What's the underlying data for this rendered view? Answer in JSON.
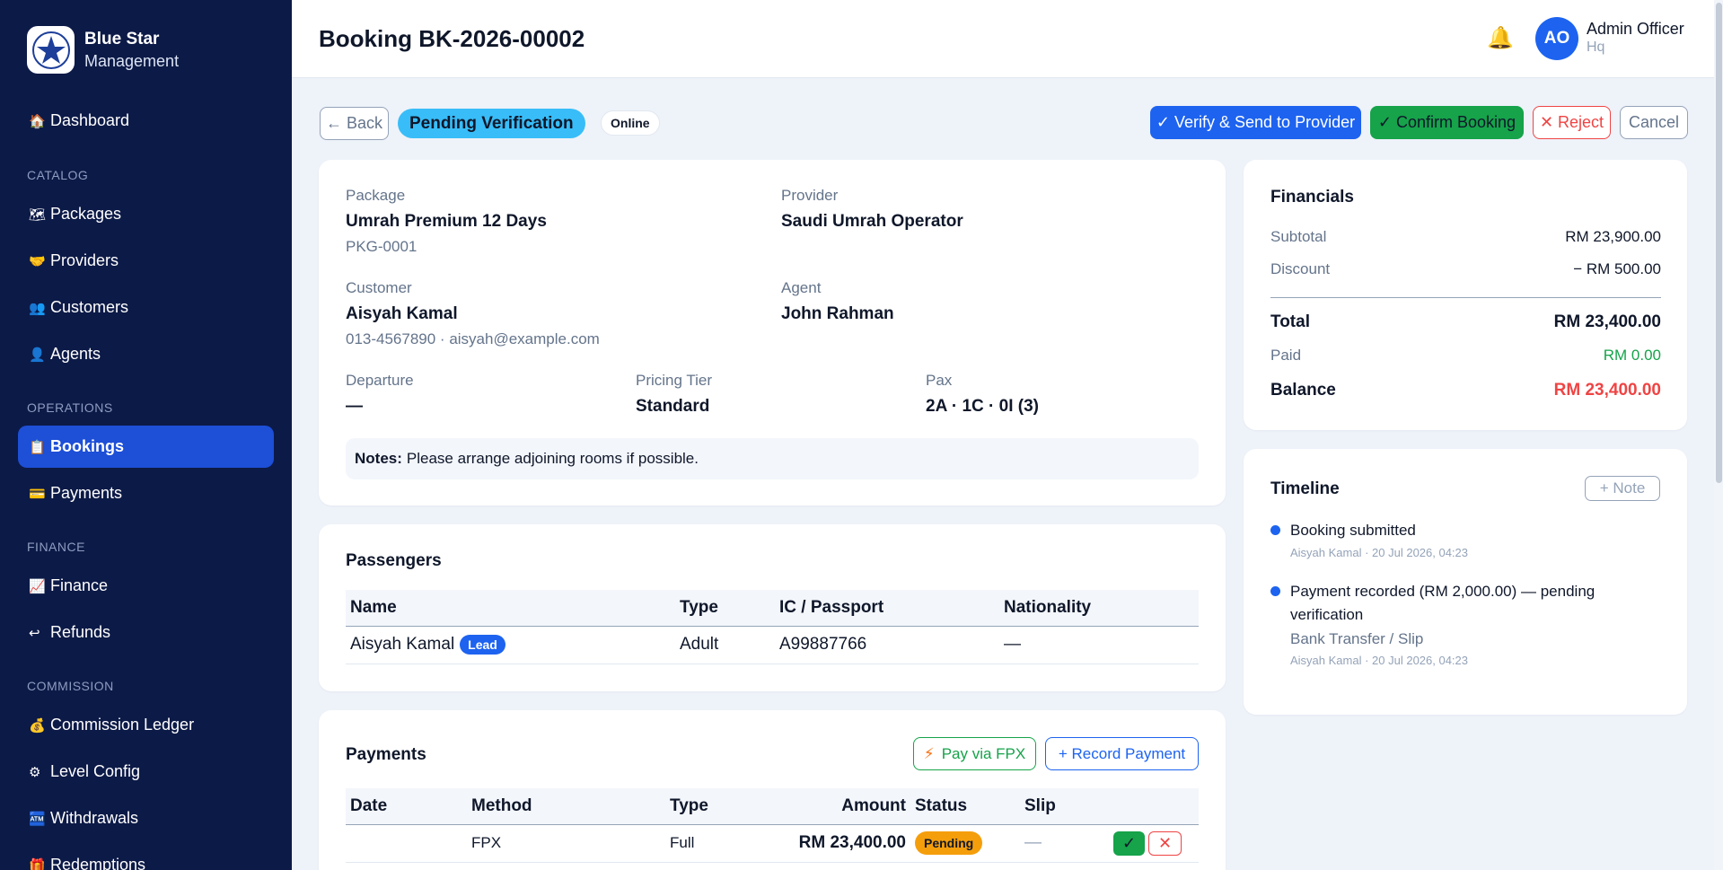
{
  "brand": {
    "name": "Blue Star",
    "sub": "Management",
    "logo_text": "BLUE STAR"
  },
  "nav": {
    "dashboard": {
      "label": "Dashboard",
      "icon": "🏠"
    },
    "catalog_label": "CATALOG",
    "packages": {
      "label": "Packages",
      "icon": "🗺"
    },
    "providers": {
      "label": "Providers",
      "icon": "🤝"
    },
    "customers": {
      "label": "Customers",
      "icon": "👥"
    },
    "agents": {
      "label": "Agents",
      "icon": "👤"
    },
    "operations_label": "OPERATIONS",
    "bookings": {
      "label": "Bookings",
      "icon": "📋"
    },
    "payments": {
      "label": "Payments",
      "icon": "💳"
    },
    "finance_label": "FINANCE",
    "finance": {
      "label": "Finance",
      "icon": "📈"
    },
    "refunds": {
      "label": "Refunds",
      "icon": "↩"
    },
    "commission_label": "COMMISSION",
    "ledger": {
      "label": "Commission Ledger",
      "icon": "💰"
    },
    "level": {
      "label": "Level Config",
      "icon": "⚙"
    },
    "withdrawals": {
      "label": "Withdrawals",
      "icon": "🏧"
    },
    "redemptions": {
      "label": "Redemptions",
      "icon": "🎁"
    }
  },
  "header": {
    "title": "Booking BK-2026-00002",
    "avatar_initials": "AO",
    "user_name": "Admin Officer",
    "user_role": "Hq"
  },
  "actions": {
    "back": "← Back",
    "status": "Pending Verification",
    "channel": "Online",
    "verify": "✓ Verify & Send to Provider",
    "confirm": "✓ Confirm Booking",
    "reject": "✕ Reject",
    "cancel": "Cancel"
  },
  "details": {
    "package_label": "Package",
    "package_name": "Umrah Premium 12 Days",
    "package_code": "PKG-0001",
    "provider_label": "Provider",
    "provider_name": "Saudi Umrah Operator",
    "customer_label": "Customer",
    "customer_name": "Aisyah Kamal",
    "customer_contact": "013-4567890 · aisyah@example.com",
    "agent_label": "Agent",
    "agent_name": "John Rahman",
    "departure_label": "Departure",
    "departure_value": "—",
    "tier_label": "Pricing Tier",
    "tier_value": "Standard",
    "pax_label": "Pax",
    "pax_value": "2A · 1C · 0I (3)",
    "notes_label": "Notes:",
    "notes_text": "Please arrange adjoining rooms if possible."
  },
  "passengers": {
    "title": "Passengers",
    "columns": [
      "Name",
      "Type",
      "IC / Passport",
      "Nationality"
    ],
    "rows": [
      {
        "name": "Aisyah Kamal",
        "badge": "Lead",
        "type": "Adult",
        "ic": "A99887766",
        "nationality": "—"
      }
    ]
  },
  "payments": {
    "title": "Payments",
    "fpx_label": "Pay via FPX",
    "record_label": "+ Record Payment",
    "columns": [
      "Date",
      "Method",
      "Type",
      "Amount",
      "Status",
      "Slip"
    ],
    "rows": [
      {
        "date": "",
        "method": "FPX",
        "type": "Full",
        "amount": "RM 23,400.00",
        "status": "Pending",
        "slip": "—",
        "approve": "✓",
        "decline": "✕"
      }
    ]
  },
  "financials": {
    "title": "Financials",
    "subtotal_label": "Subtotal",
    "subtotal": "RM 23,900.00",
    "discount_label": "Discount",
    "discount": "− RM 500.00",
    "total_label": "Total",
    "total": "RM 23,400.00",
    "paid_label": "Paid",
    "paid": "RM 0.00",
    "balance_label": "Balance",
    "balance": "RM 23,400.00"
  },
  "timeline": {
    "title": "Timeline",
    "note_button": "+ Note",
    "events": [
      {
        "title": "Booking submitted",
        "detail": "",
        "meta": "Aisyah Kamal · 20 Jul 2026, 04:23"
      },
      {
        "title": "Payment recorded (RM 2,000.00) — pending verification",
        "detail": "Bank Transfer / Slip",
        "meta": "Aisyah Kamal · 20 Jul 2026, 04:23"
      }
    ]
  },
  "colors": {
    "sidebar": "#0c1a47",
    "primary": "#1d63f0",
    "success": "#16a34a",
    "danger": "#ef4444",
    "warning": "#f59e0b",
    "info": "#38bdf8"
  }
}
